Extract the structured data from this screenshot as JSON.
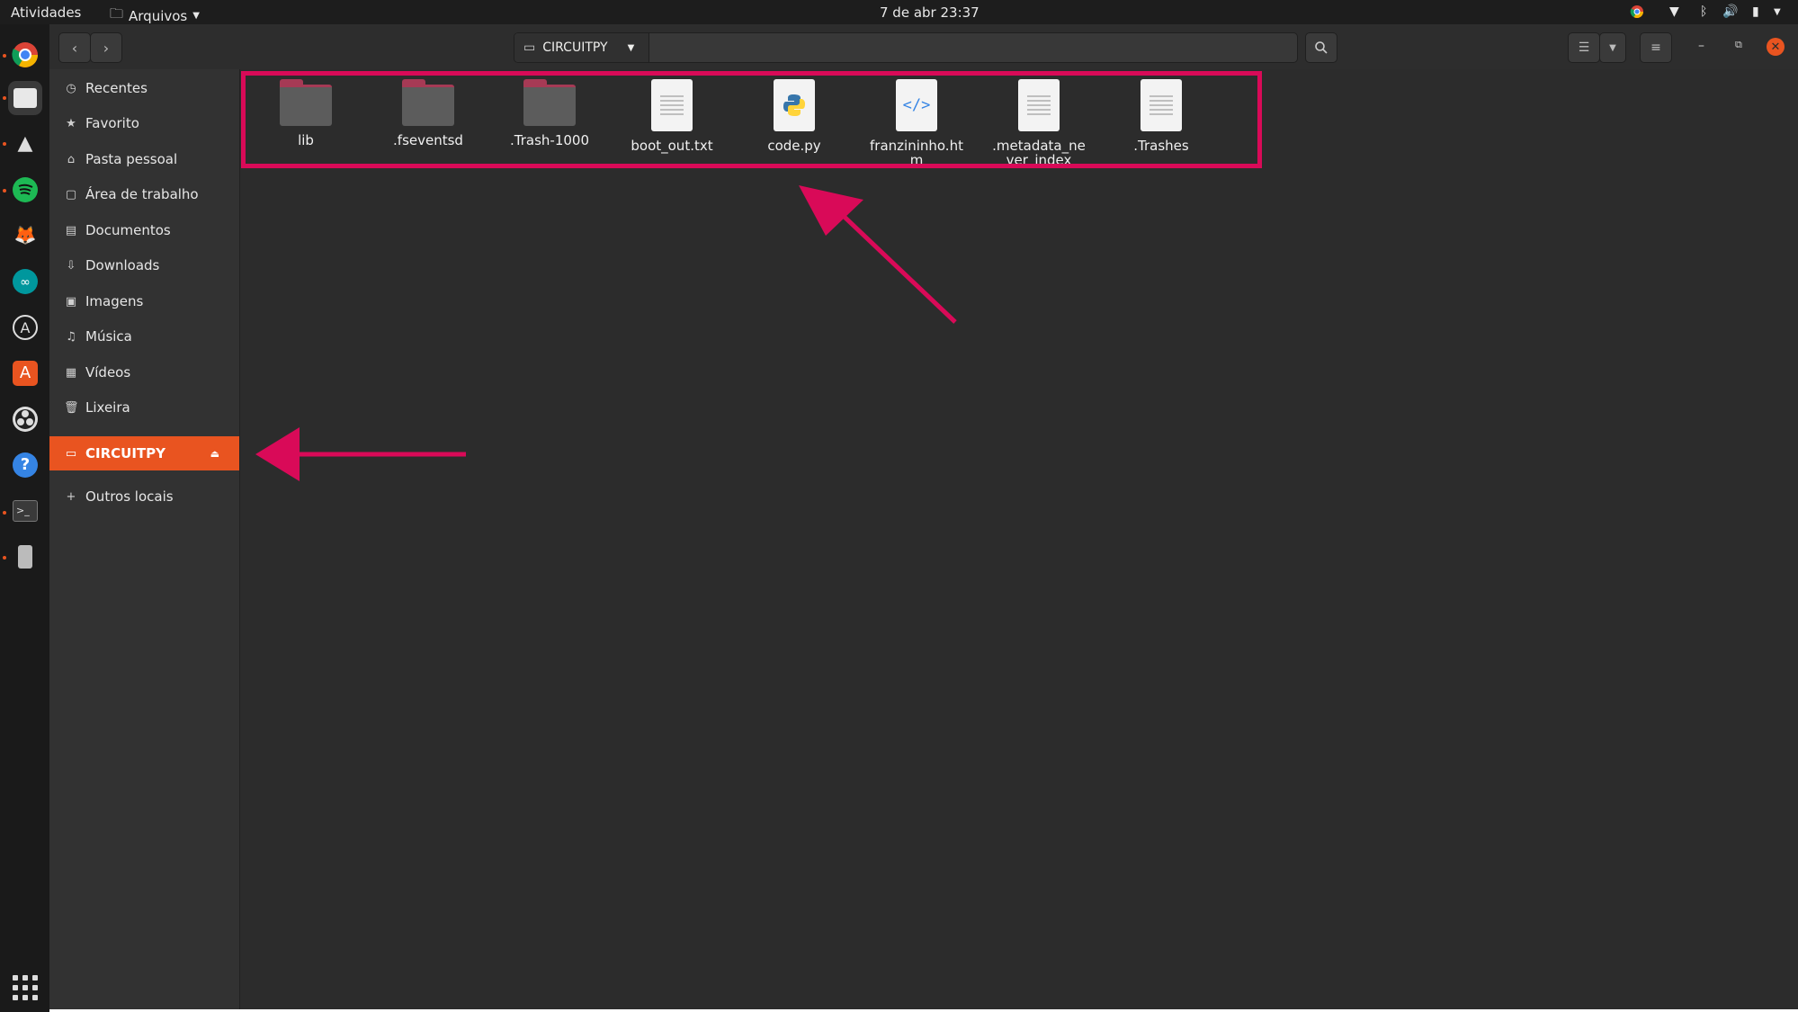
{
  "topbar": {
    "activities": "Atividades",
    "app_name": "Arquivos",
    "clock": "7 de abr  23:37"
  },
  "path": {
    "location": "CIRCUITPY"
  },
  "sidebar": {
    "items": [
      {
        "label": "Recentes",
        "icon": "clock-icon"
      },
      {
        "label": "Favorito",
        "icon": "star-icon"
      },
      {
        "label": "Pasta pessoal",
        "icon": "home-icon"
      },
      {
        "label": "Área de trabalho",
        "icon": "desktop-icon"
      },
      {
        "label": "Documentos",
        "icon": "document-icon"
      },
      {
        "label": "Downloads",
        "icon": "download-icon"
      },
      {
        "label": "Imagens",
        "icon": "image-icon"
      },
      {
        "label": "Música",
        "icon": "music-icon"
      },
      {
        "label": "Vídeos",
        "icon": "video-icon"
      },
      {
        "label": "Lixeira",
        "icon": "trash-icon"
      }
    ],
    "device": {
      "label": "CIRCUITPY",
      "icon": "drive-icon"
    },
    "other": {
      "label": "Outros locais",
      "icon": "plus-icon"
    }
  },
  "files": [
    {
      "name": "lib",
      "type": "folder"
    },
    {
      "name": ".fseventsd",
      "type": "folder"
    },
    {
      "name": ".Trash-1000",
      "type": "folder"
    },
    {
      "name": "boot_out.txt",
      "type": "text"
    },
    {
      "name": "code.py",
      "type": "python"
    },
    {
      "name": "franzininho.htm",
      "type": "html"
    },
    {
      "name": ".metadata_never_index",
      "type": "text"
    },
    {
      "name": ".Trashes",
      "type": "text"
    }
  ],
  "colors": {
    "accent": "#e95420",
    "annotation": "#d90a58",
    "folder_tab": "#a63a55"
  }
}
